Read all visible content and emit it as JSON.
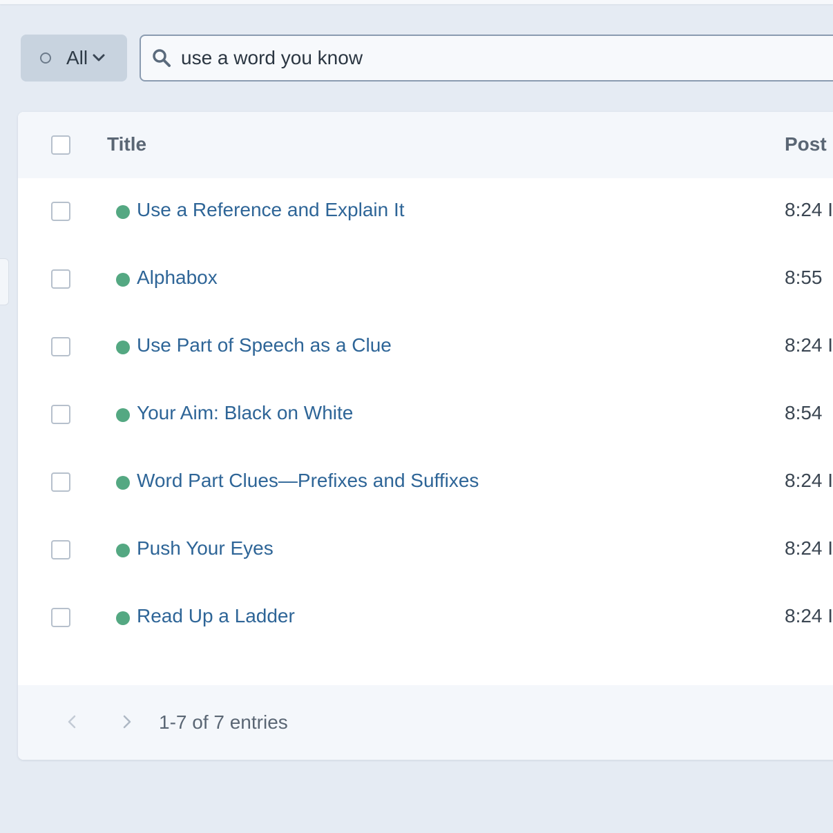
{
  "filter": {
    "label": "All",
    "icon": "status-ring-icon"
  },
  "search": {
    "value": "use a word you know",
    "icon": "search-icon"
  },
  "table": {
    "columns": {
      "title": "Title",
      "post": "Post"
    },
    "rows": [
      {
        "title": "Use a Reference and Explain It",
        "time": "8:24 I",
        "status_color": "#54a882"
      },
      {
        "title": "Alphabox",
        "time": "8:55",
        "status_color": "#54a882"
      },
      {
        "title": "Use Part of Speech as a Clue",
        "time": "8:24 I",
        "status_color": "#54a882"
      },
      {
        "title": "Your Aim: Black on White",
        "time": "8:54",
        "status_color": "#54a882"
      },
      {
        "title": "Word Part Clues—Prefixes and Suffixes",
        "time": "8:24 I",
        "status_color": "#54a882"
      },
      {
        "title": "Push Your Eyes",
        "time": "8:24 I",
        "status_color": "#54a882"
      },
      {
        "title": "Read Up a Ladder",
        "time": "8:24 I",
        "status_color": "#54a882"
      }
    ]
  },
  "pagination": {
    "summary": "1-7 of 7 entries"
  },
  "colors": {
    "link": "#2e6597",
    "published": "#54a882",
    "background": "#e5ebf3"
  }
}
